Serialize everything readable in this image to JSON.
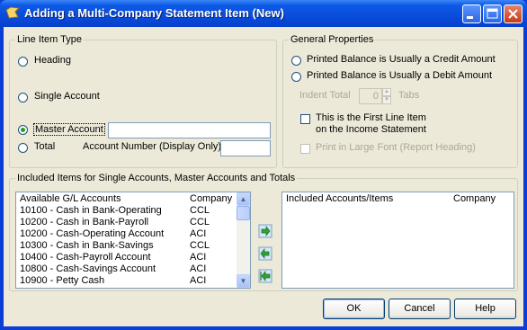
{
  "window": {
    "title": "Adding a Multi-Company Statement Item  (New)"
  },
  "line_item_type": {
    "group_label": "Line Item Type",
    "heading": "Heading",
    "single_account": "Single Account",
    "master_account": "Master Account",
    "total": "Total",
    "account_number_label": "Account Number (Display Only)",
    "master_account_value": "",
    "account_number_value": ""
  },
  "general_properties": {
    "group_label": "General Properties",
    "credit": "Printed Balance is Usually a Credit Amount",
    "debit": "Printed Balance is Usually a Debit Amount",
    "indent_label": "Indent Total",
    "indent_value": "0",
    "tabs_label": "Tabs",
    "first_line_1": "This is the First Line Item",
    "first_line_2": "on the Income Statement",
    "large_font": "Print in Large Font (Report Heading)"
  },
  "included": {
    "group_label": "Included Items for Single Accounts, Master Accounts and Totals",
    "available_header": "Available G/L Accounts",
    "company_header": "Company",
    "included_header": "Included Accounts/Items",
    "included_company_header": "Company",
    "accounts": [
      {
        "name": "10100 - Cash in Bank-Operating",
        "company": "CCL"
      },
      {
        "name": "10200 - Cash in Bank-Payroll",
        "company": "CCL"
      },
      {
        "name": "10200 - Cash-Operating Account",
        "company": "ACI"
      },
      {
        "name": "10300 - Cash in Bank-Savings",
        "company": "CCL"
      },
      {
        "name": "10400 - Cash-Payroll Account",
        "company": "ACI"
      },
      {
        "name": "10800 - Cash-Savings Account",
        "company": "ACI"
      },
      {
        "name": "10900 - Petty Cash",
        "company": "ACI"
      }
    ]
  },
  "buttons": {
    "ok": "OK",
    "cancel": "Cancel",
    "help": "Help"
  }
}
